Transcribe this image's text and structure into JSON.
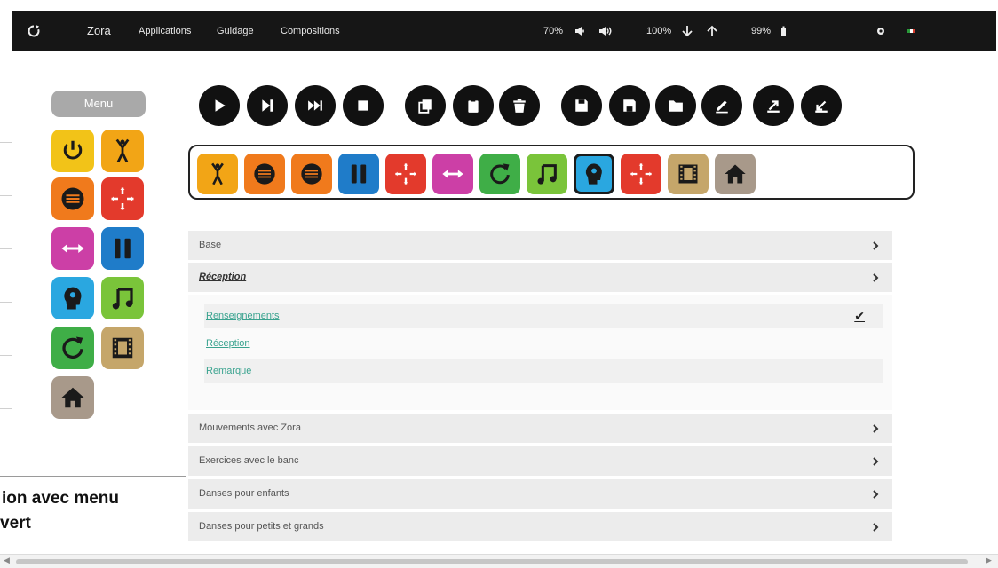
{
  "topbar": {
    "brand": "Zora",
    "menu": [
      "Applications",
      "Guidage",
      "Compositions"
    ],
    "volume": "70%",
    "speed": "100%",
    "battery": "99%"
  },
  "menu": {
    "label": "Menu"
  },
  "menu_tiles": [
    {
      "name": "power-icon",
      "color": "#f2c318"
    },
    {
      "name": "stretch-figure-icon",
      "color": "#f2a516"
    },
    {
      "name": "speech-icon",
      "color": "#f07a1c"
    },
    {
      "name": "move-arrows-icon",
      "color": "#e33a2c"
    },
    {
      "name": "horizontal-arrows-icon",
      "color": "#cc3fa6"
    },
    {
      "name": "pause-icon",
      "color": "#1f7cc9"
    },
    {
      "name": "head-idea-icon",
      "color": "#2aa7e0"
    },
    {
      "name": "music-note-icon",
      "color": "#7ac43a"
    },
    {
      "name": "repeat-icon",
      "color": "#3fae47"
    },
    {
      "name": "film-icon",
      "color": "#c5a66a"
    },
    {
      "name": "home-icon",
      "color": "#a8998a"
    }
  ],
  "toolbar_buttons": [
    "play-icon",
    "next-icon",
    "fast-forward-icon",
    "stop-icon",
    "copy-icon",
    "paste-icon",
    "trash-icon",
    "save-icon",
    "save-as-icon",
    "open-folder-icon",
    "edit-icon",
    "export-icon",
    "import-icon"
  ],
  "composition_tiles": [
    {
      "name": "stretch-figure-icon",
      "color": "#f2a516"
    },
    {
      "name": "speech-icon",
      "color": "#f07a1c"
    },
    {
      "name": "speech-icon",
      "color": "#f07a1c"
    },
    {
      "name": "pause-icon",
      "color": "#1f7cc9"
    },
    {
      "name": "move-arrows-icon",
      "color": "#e33a2c"
    },
    {
      "name": "horizontal-arrows-icon",
      "color": "#cc3fa6"
    },
    {
      "name": "repeat-icon",
      "color": "#3fae47"
    },
    {
      "name": "music-note-icon",
      "color": "#7ac43a"
    },
    {
      "name": "head-idea-icon",
      "color": "#2aa7e0",
      "selected": true
    },
    {
      "name": "move-arrows-icon",
      "color": "#e33a2c"
    },
    {
      "name": "film-icon",
      "color": "#c5a66a"
    },
    {
      "name": "home-icon",
      "color": "#a8998a"
    }
  ],
  "accordion": {
    "base": "Base",
    "reception": "Réception",
    "sub_items": [
      "Renseignements",
      "Réception",
      "Remarque"
    ],
    "sections": [
      "Mouvements avec Zora",
      "Exercices avec le banc",
      "Danses pour enfants",
      "Danses pour petits et grands"
    ]
  },
  "caption": {
    "line1": "ion avec menu",
    "line2": "vert"
  }
}
